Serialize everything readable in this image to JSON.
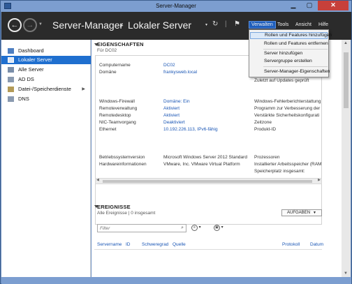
{
  "window": {
    "title": "Server-Manager"
  },
  "header": {
    "breadcrumb_root": "Server-Manager",
    "breadcrumb_separator": "▸",
    "breadcrumb_current": "Lokaler Server",
    "menus": [
      "Verwalten",
      "Tools",
      "Ansicht",
      "Hilfe"
    ]
  },
  "manage_menu": {
    "items": [
      "Rollen und Features hinzufügen",
      "Rollen und Features entfernen",
      "Server hinzufügen",
      "Servergruppe erstellen",
      "Server-Manager-Eigenschaften"
    ]
  },
  "sidebar": {
    "items": [
      {
        "label": "Dashboard",
        "icon": "dashboard-icon"
      },
      {
        "label": "Lokaler Server",
        "icon": "server-icon"
      },
      {
        "label": "Alle Server",
        "icon": "servers-icon"
      },
      {
        "label": "AD DS",
        "icon": "ad-ds-icon"
      },
      {
        "label": "Datei-/Speicherdienste",
        "icon": "file-storage-icon"
      },
      {
        "label": "DNS",
        "icon": "dns-icon"
      }
    ]
  },
  "properties": {
    "title": "EIGENSCHAFTEN",
    "subtitle": "Für DC02",
    "rows": [
      {
        "label": "Computername",
        "value": "DC02"
      },
      {
        "label": "Domäne",
        "value": "frankysweb.local"
      },
      {
        "label": "Windows-Firewall",
        "value": "Domäne: Ein"
      },
      {
        "label": "Remoteverwaltung",
        "value": "Aktiviert"
      },
      {
        "label": "Remotedesktop",
        "value": "Aktiviert"
      },
      {
        "label": "NIC-Teamvorgang",
        "value": "Deaktiviert"
      },
      {
        "label": "Ethernet",
        "value": "10.192.226.113, IPv6-fähig"
      },
      {
        "label": "Betriebssystemversion",
        "value": "Microsoft Windows Server 2012 Standard"
      },
      {
        "label": "Hardwareinformationen",
        "value": "VMware, Inc. VMware Virtual Platform"
      }
    ],
    "right_column": [
      "Zuletzt auf Updates geprüft",
      "Windows-Fehlerberichterstattung",
      "Programm zur Verbesserung der",
      "Verstärkte Sicherheitskonfigurati",
      "Zeitzone",
      "Produkt-ID",
      "Prozessoren",
      "Installierter Arbeitsspeicher (RAM",
      "Speicherplatz insgesamt:"
    ]
  },
  "events": {
    "title": "EREIGNISSE",
    "subtitle": "Alle Ereignisse | 0 insgesamt",
    "tasks_label": "AUFGABEN",
    "filter_placeholder": "Filter",
    "columns": [
      "Servername",
      "ID",
      "Schweregrad",
      "Quelle",
      "Protokoll",
      "Datum"
    ]
  }
}
